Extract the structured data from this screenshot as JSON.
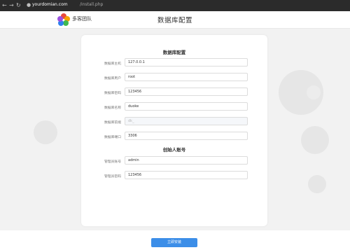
{
  "browser": {
    "back": "←",
    "forward": "→",
    "reload": "↻",
    "url_domain": "yourdomian.com",
    "url_path": "/install.php"
  },
  "header": {
    "logo_text": "多客团队",
    "page_title": "数据库配置"
  },
  "db_section": {
    "title": "数据库配置",
    "rows": [
      {
        "label": "数据库主机",
        "value": "127.0.0.1"
      },
      {
        "label": "数据库用户",
        "value": "root"
      },
      {
        "label": "数据库密码",
        "value": "123456"
      },
      {
        "label": "数据库名称",
        "value": "duoke"
      },
      {
        "label": "数据库前缀",
        "value": "dk_"
      },
      {
        "label": "数据库端口",
        "value": "3306"
      }
    ]
  },
  "admin_section": {
    "title": "创始人账号",
    "rows": [
      {
        "label": "管理员账号",
        "value": "admin"
      },
      {
        "label": "管理员密码",
        "value": "123456"
      }
    ]
  },
  "footer": {
    "install_button": "立即安装"
  },
  "colors": {
    "accent": "#3c8ee8",
    "logo": [
      "#e94b3c",
      "#f4a300",
      "#3fb950",
      "#2f80ed",
      "#9b51e0"
    ]
  }
}
